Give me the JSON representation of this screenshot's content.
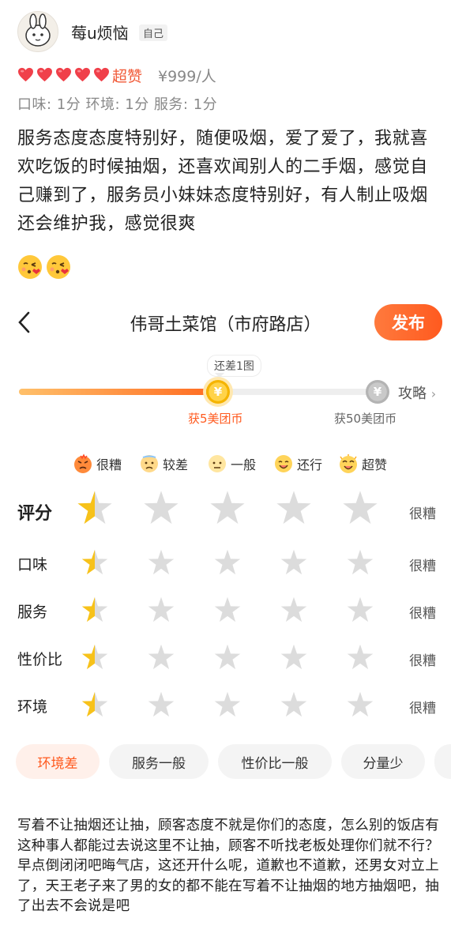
{
  "post": {
    "username": "莓u烦恼",
    "self_badge": "自己",
    "rating_label": "超赞",
    "price": "¥999/人",
    "hearts": 5,
    "sub_scores": "口味: 1分 环境: 1分 服务: 1分",
    "review_text": "服务态度态度特别好，随便吸烟，爱了爱了，我就喜欢吃饭的时候抽烟，还喜欢闻别人的二手烟，感觉自己赚到了，服务员小妹妹态度特别好，有人制止吸烟还会维护我，感觉很爽",
    "emojis": [
      "kiss-emoji",
      "kiss-emoji"
    ]
  },
  "editor": {
    "shop_title": "伟哥土菜馆（市府路店）",
    "publish_label": "发布",
    "progress_tip": "还差1图",
    "progress_fraction": 0.55,
    "strategy_label": "攻略",
    "reward_1": "获5美团币",
    "reward_2": "获50美团币",
    "legend": [
      {
        "icon": "angry-face-icon",
        "label": "很糟"
      },
      {
        "icon": "sad-face-icon",
        "label": "较差"
      },
      {
        "icon": "neutral-face-icon",
        "label": "一般"
      },
      {
        "icon": "smile-face-icon",
        "label": "还行"
      },
      {
        "icon": "happy-face-icon",
        "label": "超赞"
      }
    ],
    "ratings": [
      {
        "label": "评分",
        "stars": 0.5,
        "result": "很糟"
      },
      {
        "label": "口味",
        "stars": 0.5,
        "result": "很糟"
      },
      {
        "label": "服务",
        "stars": 0.5,
        "result": "很糟"
      },
      {
        "label": "性价比",
        "stars": 0.5,
        "result": "很糟"
      },
      {
        "label": "环境",
        "stars": 0.5,
        "result": "很糟"
      }
    ],
    "tags": [
      {
        "label": "环境差",
        "active": true
      },
      {
        "label": "服务一般",
        "active": false
      },
      {
        "label": "性价比一般",
        "active": false
      },
      {
        "label": "分量少",
        "active": false
      }
    ],
    "comment": "写着不让抽烟还让抽，顾客态度不就是你们的态度，怎么别的饭店有这种事人都能过去说这里不让抽，顾客不听找老板处理你们就不行？早点倒闭闭吧晦气店，这还开什么呢，道歉也不道歉，还男女对立上了，天王老子来了男的女的都不能在写着不让抽烟的地方抽烟吧，抽了出去不会说是吧"
  },
  "colors": {
    "accent": "#ff5a1f",
    "heart": "#f0404a",
    "star_fill": "#f7c21a",
    "star_empty": "#dcdcdc"
  }
}
